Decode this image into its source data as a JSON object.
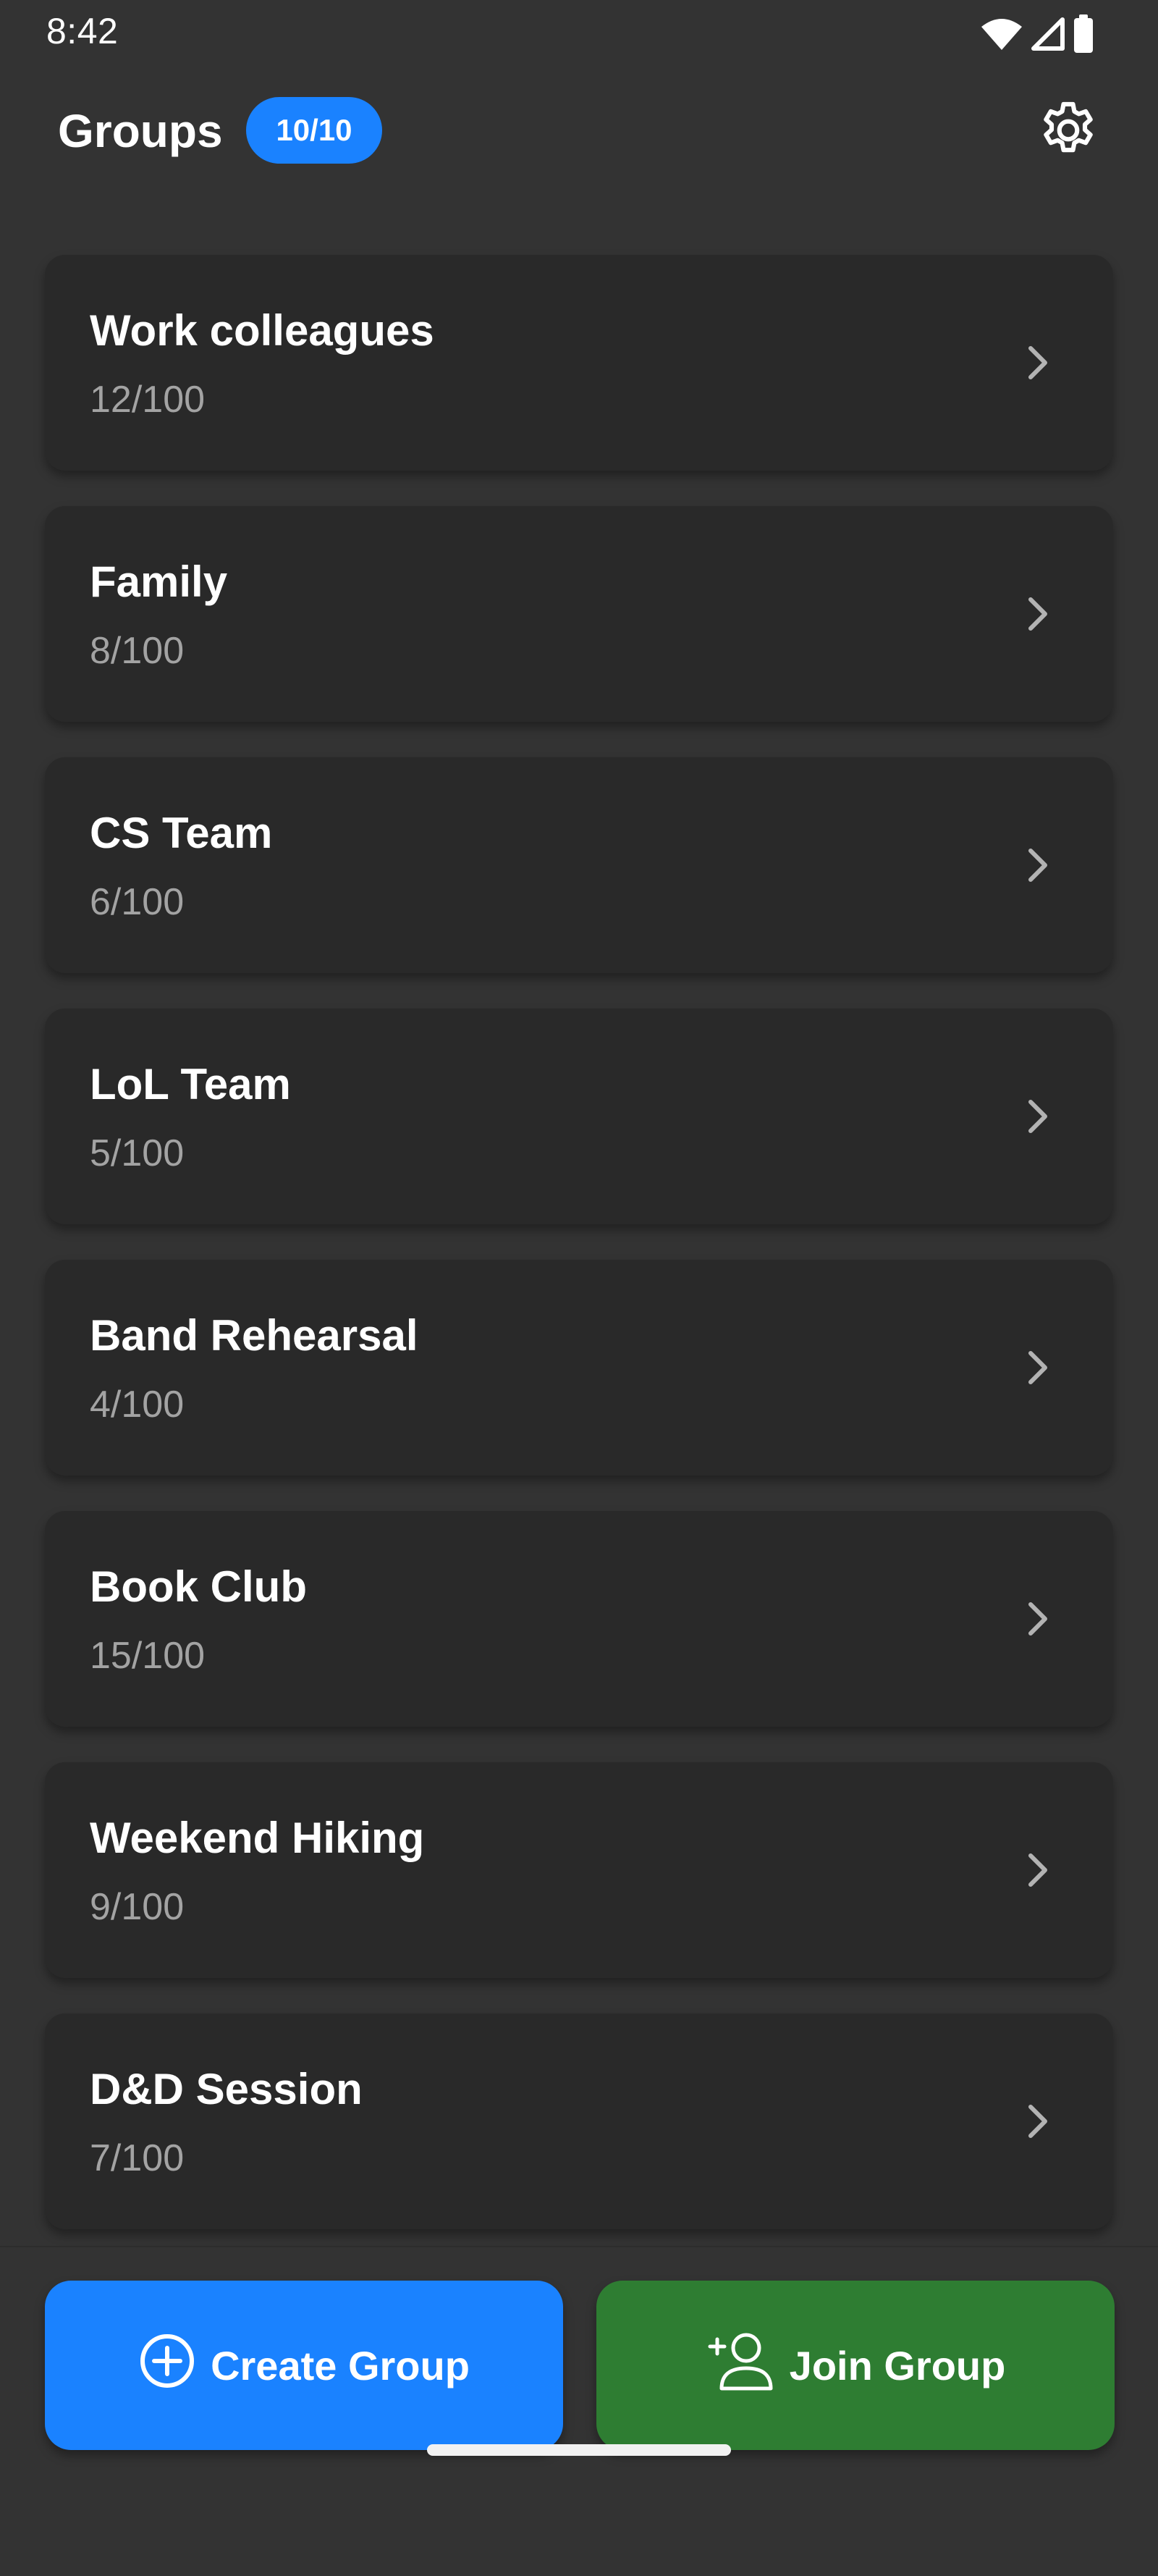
{
  "status_bar": {
    "time": "8:42",
    "icons": [
      "wifi-icon",
      "cellular-signal-icon",
      "battery-icon"
    ]
  },
  "header": {
    "title": "Groups",
    "badge": "10/10",
    "settings_icon": "gear-icon"
  },
  "groups": [
    {
      "name": "Work colleagues",
      "count": "12/100"
    },
    {
      "name": "Family",
      "count": "8/100"
    },
    {
      "name": "CS Team",
      "count": "6/100"
    },
    {
      "name": "LoL Team",
      "count": "5/100"
    },
    {
      "name": "Band Rehearsal",
      "count": "4/100"
    },
    {
      "name": "Book Club",
      "count": "15/100"
    },
    {
      "name": "Weekend Hiking",
      "count": "9/100"
    },
    {
      "name": "D&D Session",
      "count": "7/100"
    }
  ],
  "actions": {
    "create_label": "Create Group",
    "create_icon": "add-circle-icon",
    "join_label": "Join Group",
    "join_icon": "add-person-icon"
  },
  "colors": {
    "background": "#333333",
    "card": "#292929",
    "accent_blue": "#1a82ff",
    "accent_green": "#2e7d32",
    "secondary_text": "#a3a3a3"
  }
}
